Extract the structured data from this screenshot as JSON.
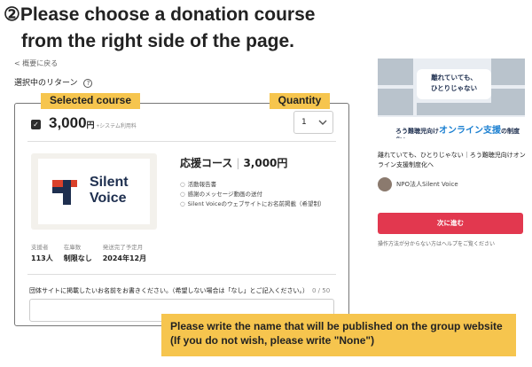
{
  "heading": {
    "line1": "②Please choose a donation course",
    "line2": "from the right side of the page."
  },
  "back_link": "< 概要に戻る",
  "section_title": "選択中のリターン",
  "help_icon": "?",
  "tags": {
    "selected_course": "Selected course",
    "quantity": "Quantity"
  },
  "course": {
    "check": "✓",
    "price": "3,000",
    "currency": "円",
    "fee_note": "+システム利用料",
    "quantity": "1",
    "name": "応援コース",
    "name_price": "3,000円",
    "logo_text_1": "Silent",
    "logo_text_2": "Voice",
    "rewards": [
      "活動報告書",
      "感謝のメッセージ動画の送付",
      "Silent Voiceのウェブサイトにお名前掲載（希望制）"
    ],
    "stats": [
      {
        "label": "支援者",
        "value": "113人"
      },
      {
        "label": "在庫数",
        "value": "制限なし"
      },
      {
        "label": "発送完了予定月",
        "value": "2024年12月"
      }
    ]
  },
  "name_field": {
    "prompt": "団体サイトに掲載したいお名前をお書きください。（希望しない場合は「なし」とご記入ください。）",
    "counter": "0 / 50",
    "value": ""
  },
  "tooltip": {
    "line1": "Please write the name that will be published on the group website",
    "line2": "(If you do not wish, please write \"None\")"
  },
  "sidebar": {
    "banner_bubble_1": "離れていても、",
    "banner_bubble_2": "ひとりじゃない",
    "banner_strip_prefix": "ろう難聴児向け",
    "banner_strip_highlight": "オンライン支援",
    "banner_strip_suffix": "の制度化へ",
    "project_title": "離れていても、ひとりじゃない｜ろう難聴児向けオンライン支援制度化へ",
    "org_name": "NPO法人Silent Voice",
    "next_button": "次に進む",
    "help_text": "操作方法が分からない方はヘルプをご覧ください"
  },
  "colors": {
    "accent_yellow": "#f6c54e",
    "button_red": "#e2384f",
    "logo_navy": "#1e2f4f",
    "logo_red": "#d9412b"
  }
}
